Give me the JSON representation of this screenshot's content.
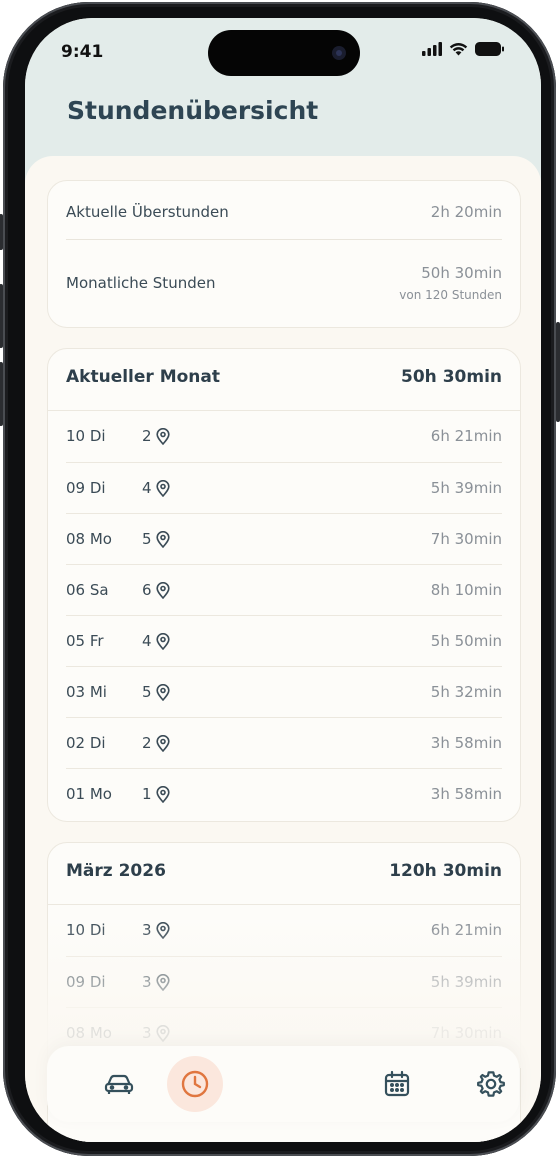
{
  "status_bar": {
    "time": "9:41"
  },
  "header": {
    "title": "Stundenübersicht"
  },
  "summary": {
    "overtime_label": "Aktuelle Überstunden",
    "overtime_value": "2h 20min",
    "monthly_label": "Monatliche Stunden",
    "monthly_value": "50h 30min",
    "monthly_sub": "von 120 Stunden"
  },
  "current_month": {
    "title": "Aktueller Monat",
    "total": "50h 30min",
    "rows": [
      {
        "day": "10 Di",
        "count": "2",
        "duration": "6h 21min"
      },
      {
        "day": "09 Di",
        "count": "4",
        "duration": "5h 39min"
      },
      {
        "day": "08 Mo",
        "count": "5",
        "duration": "7h 30min"
      },
      {
        "day": "06 Sa",
        "count": "6",
        "duration": "8h 10min"
      },
      {
        "day": "05 Fr",
        "count": "4",
        "duration": "5h 50min"
      },
      {
        "day": "03 Mi",
        "count": "5",
        "duration": "5h 32min"
      },
      {
        "day": "02 Di",
        "count": "2",
        "duration": "3h 58min"
      },
      {
        "day": "01 Mo",
        "count": "1",
        "duration": "3h 58min"
      }
    ]
  },
  "previous_month": {
    "title": "März 2026",
    "total": "120h 30min",
    "rows": [
      {
        "day": "10 Di",
        "count": "3",
        "duration": "6h 21min"
      },
      {
        "day": "09 Di",
        "count": "3",
        "duration": "5h 39min"
      },
      {
        "day": "08 Mo",
        "count": "3",
        "duration": "7h 30min"
      }
    ]
  },
  "nav": {
    "items": [
      "car-icon",
      "clock-icon",
      "calendar-icon",
      "settings-icon"
    ],
    "active": "clock-icon",
    "accent": "#e0763f"
  }
}
